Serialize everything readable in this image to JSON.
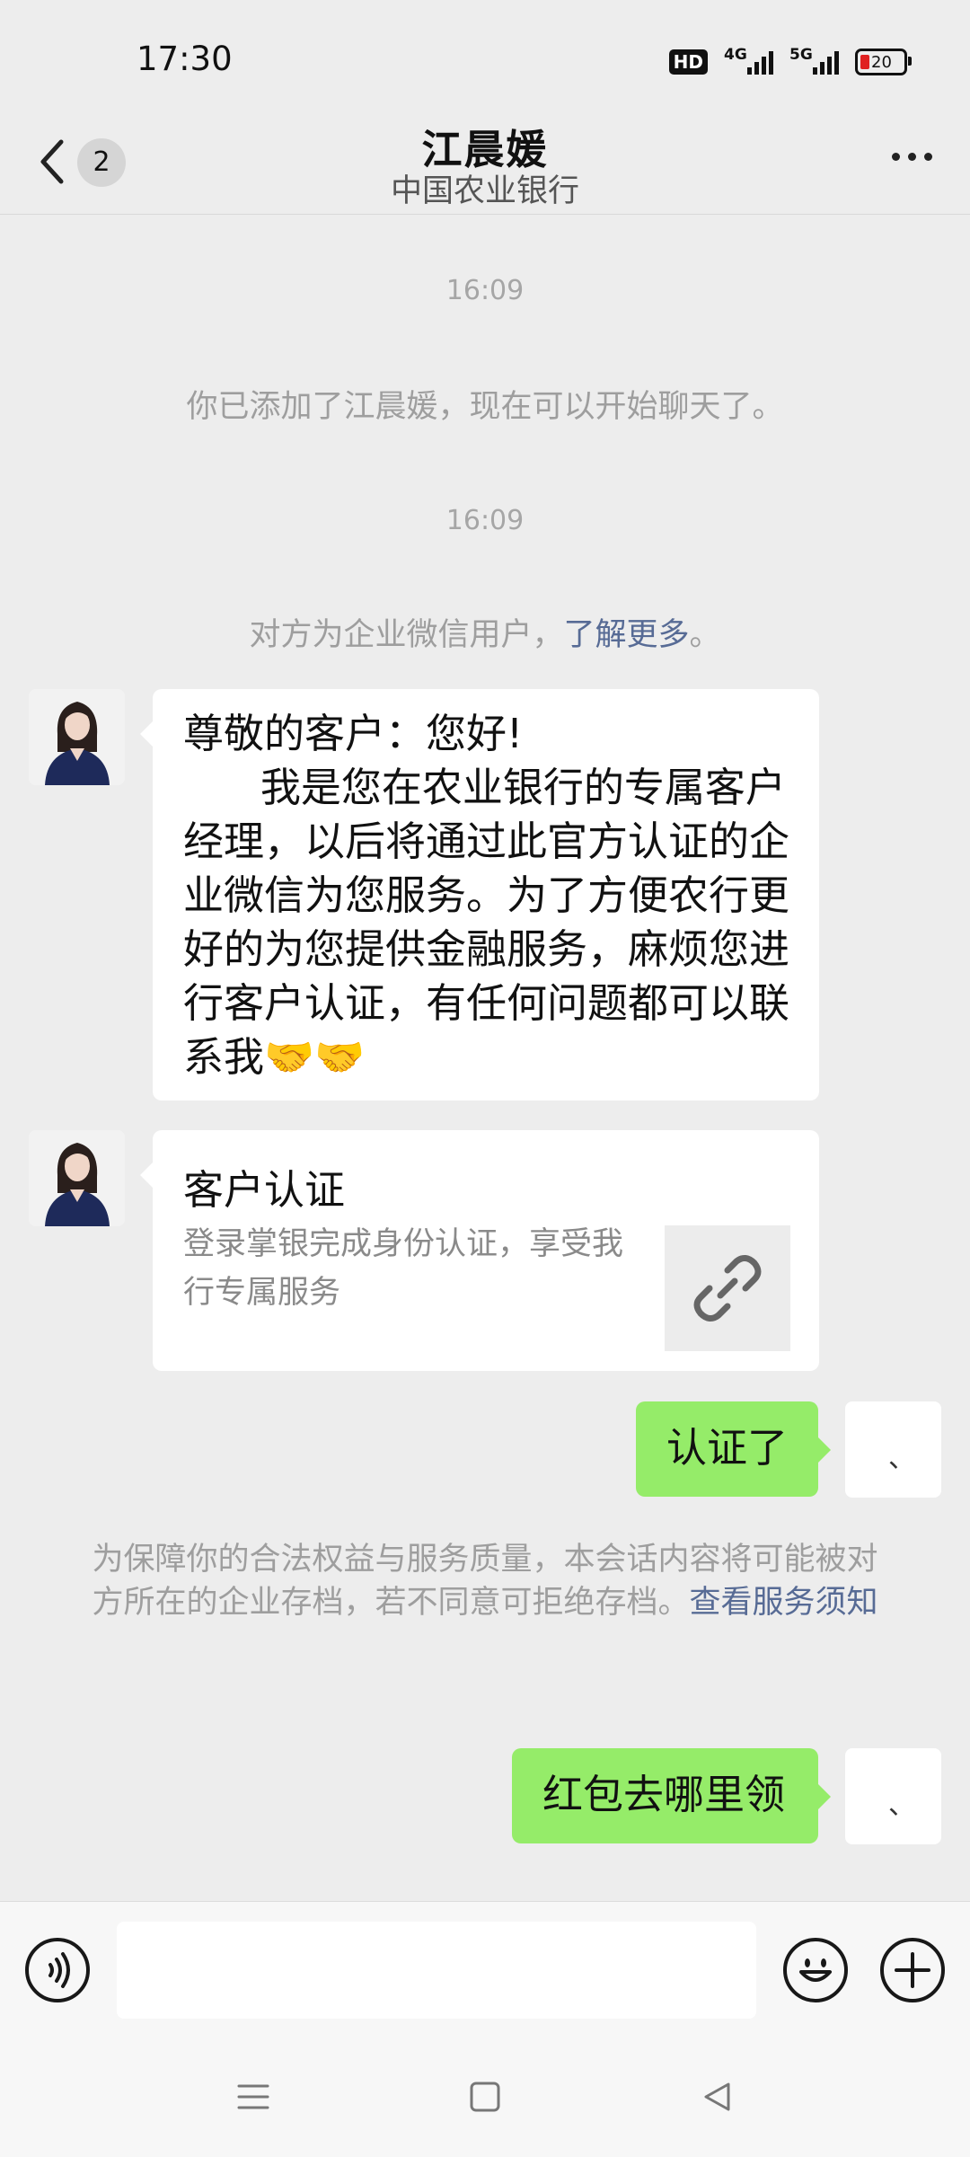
{
  "status_bar": {
    "time": "17:30",
    "network_1": "4G",
    "network_2": "5G",
    "hd_label": "HD",
    "battery_level": "20"
  },
  "header": {
    "unread_count": "2",
    "contact_name": "江晨媛",
    "organization": "中国农业银行",
    "back_icon": "chevron-left-icon",
    "more_icon": "more-dots-icon"
  },
  "messages": {
    "timestamp_1": "16:09",
    "added_notice": "你已添加了江晨媛，现在可以开始聊天了。",
    "timestamp_2": "16:09",
    "enterprise_notice_text": "对方为企业微信用户，",
    "enterprise_notice_link": "了解更多",
    "enterprise_notice_end": "。",
    "greeting": "尊敬的客户：您好!\n      我是您在农业银行的专属客户经理，以后将通过此官方认证的企业微信为您服务。为了方便农行更好的为您提供金融服务，麻烦您进行客户认证，有任何问题都可以联系我🤝🤝",
    "card_title": "客户认证",
    "card_description": "登录掌银完成身份认证，享受我行专属服务",
    "card_icon": "link-icon",
    "reply_1": "认证了",
    "self_avatar_text": "、",
    "archive_notice_text": "为保障你的合法权益与服务质量，本会话内容将可能被对方所在的企业存档，若不同意可拒绝存档。",
    "archive_notice_link": "查看服务须知",
    "reply_2": "红包去哪里领"
  },
  "input_bar": {
    "voice_icon": "voice-icon",
    "emoji_icon": "emoji-icon",
    "plus_icon": "plus-icon",
    "input_value": ""
  },
  "nav_bar": {
    "menu_icon": "menu-icon",
    "home_icon": "home-icon",
    "back_icon": "back-triangle-icon"
  },
  "colors": {
    "background": "#ededed",
    "bubble_out": "#95ec69",
    "bubble_in": "#ffffff",
    "link": "#576b95"
  }
}
